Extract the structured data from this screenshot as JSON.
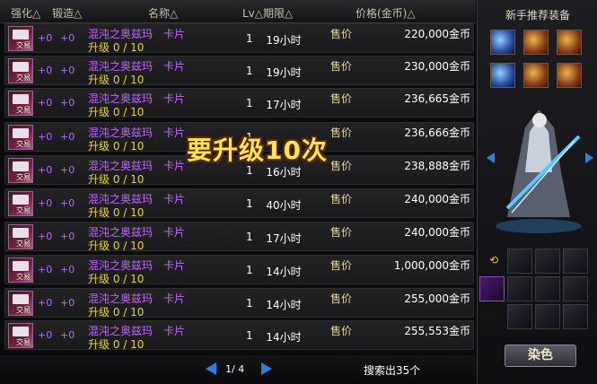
{
  "header": {
    "col_enhance": "强化△",
    "col_forge": "锻造△",
    "col_name": "名称△",
    "col_lv_period": "Lv△期限△",
    "col_price": "价格(金币)△"
  },
  "rows": [
    {
      "plus1": "+0",
      "plus2": "+0",
      "name": "混沌之奥兹玛　卡片",
      "upgrade": "升级 0 / 10",
      "lv": "1",
      "period": "19小时",
      "sell": "售价",
      "price": "220,000金币",
      "icon_label": "交易"
    },
    {
      "plus1": "+0",
      "plus2": "+0",
      "name": "混沌之奥兹玛　卡片",
      "upgrade": "升级 0 / 10",
      "lv": "1",
      "period": "19小时",
      "sell": "售价",
      "price": "230,000金币",
      "icon_label": "交易"
    },
    {
      "plus1": "+0",
      "plus2": "+0",
      "name": "混沌之奥兹玛　卡片",
      "upgrade": "升级 0 / 10",
      "lv": "1",
      "period": "17小时",
      "sell": "售价",
      "price": "236,665金币",
      "icon_label": "交易"
    },
    {
      "plus1": "+0",
      "plus2": "+0",
      "name": "混沌之奥兹玛　卡片",
      "upgrade": "升级 0 / 10",
      "lv": "1",
      "period": "",
      "sell": "售价",
      "price": "236,666金币",
      "icon_label": "交易"
    },
    {
      "plus1": "+0",
      "plus2": "+0",
      "name": "混沌之奥兹玛　卡片",
      "upgrade": "升级 0 / 10",
      "lv": "1",
      "period": "16小时",
      "sell": "售价",
      "price": "238,888金币",
      "icon_label": "交易"
    },
    {
      "plus1": "+0",
      "plus2": "+0",
      "name": "混沌之奥兹玛　卡片",
      "upgrade": "升级 0 / 10",
      "lv": "1",
      "period": "40小时",
      "sell": "售价",
      "price": "240,000金币",
      "icon_label": "交易"
    },
    {
      "plus1": "+0",
      "plus2": "+0",
      "name": "混沌之奥兹玛　卡片",
      "upgrade": "升级 0 / 10",
      "lv": "1",
      "period": "17小时",
      "sell": "售价",
      "price": "240,000金币",
      "icon_label": "交易"
    },
    {
      "plus1": "+0",
      "plus2": "+0",
      "name": "混沌之奥兹玛　卡片",
      "upgrade": "升级 0 / 10",
      "lv": "1",
      "period": "14小时",
      "sell": "售价",
      "price": "1,000,000金币",
      "icon_label": "交易"
    },
    {
      "plus1": "+0",
      "plus2": "+0",
      "name": "混沌之奥兹玛　卡片",
      "upgrade": "升级 0 / 10",
      "lv": "1",
      "period": "14小时",
      "sell": "售价",
      "price": "255,000金币",
      "icon_label": "交易"
    },
    {
      "plus1": "+0",
      "plus2": "+0",
      "name": "混沌之奥兹玛　卡片",
      "upgrade": "升级 0 / 10",
      "lv": "1",
      "period": "14小时",
      "sell": "售价",
      "price": "255,553金币",
      "icon_label": "交易"
    }
  ],
  "overlay_text": "要升级10次",
  "pagination": {
    "text": "1/ 4"
  },
  "result_count": "搜索出35个",
  "right_panel": {
    "title": "新手推荐装备",
    "dye_button": "染色"
  },
  "colors": {
    "name_purple": "#c066ff",
    "upgrade_yellow": "#e8d23a",
    "overlay_yellow": "#ffe25a",
    "accent_blue": "#2f7fd8"
  }
}
